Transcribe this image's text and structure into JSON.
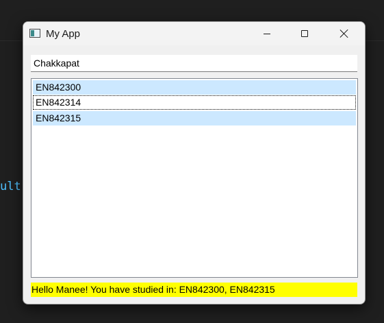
{
  "background": {
    "code_snippet": "ult"
  },
  "window": {
    "title": "My App",
    "icon": "app-window-icon",
    "controls": {
      "minimize_icon": "minimize-icon",
      "maximize_icon": "maximize-icon",
      "close_icon": "close-icon"
    }
  },
  "name_input": {
    "value": "Chakkapat"
  },
  "course_list": {
    "items": [
      {
        "label": "EN842300",
        "selected": true,
        "focused": false
      },
      {
        "label": "EN842314",
        "selected": false,
        "focused": true
      },
      {
        "label": "EN842315",
        "selected": true,
        "focused": false
      }
    ]
  },
  "status": {
    "text": "Hello Manee! You have studied in: EN842300, EN842315",
    "background_color": "#ffff00"
  },
  "colors": {
    "selection": "#cce8ff",
    "code_accent": "#4fc1ff"
  }
}
